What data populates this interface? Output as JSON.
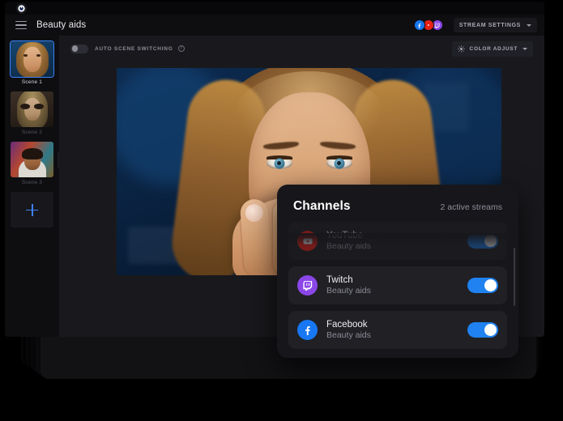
{
  "app": {
    "logo_icon": "power-logo-icon",
    "title": "Beauty aids",
    "menu_icon": "hamburger-menu-icon"
  },
  "titlebar": {
    "socials": [
      {
        "name": "facebook",
        "glyph": "f",
        "color": "#1877f2"
      },
      {
        "name": "youtube",
        "glyph": "▶",
        "color": "#e62117"
      },
      {
        "name": "twitch",
        "glyph": "▣",
        "color": "#8b46e8"
      }
    ],
    "stream_settings_label": "STREAM SETTINGS",
    "stream_settings_icon": "chevron-down-icon"
  },
  "sidebar": {
    "scenes": [
      {
        "label": "Scene 1",
        "active": true
      },
      {
        "label": "Scene 2",
        "active": false
      },
      {
        "label": "Scene 3",
        "active": false
      }
    ],
    "add_scene_icon": "plus-icon",
    "collapse_icon": "chevron-right-icon"
  },
  "stage": {
    "auto_scene_switching_label": "AUTO SCENE SWITCHING",
    "auto_scene_switching_on": false,
    "info_icon": "info-icon",
    "info_glyph": "?",
    "color_adjust_label": "COLOR ADJUST",
    "color_adjust_icon": "brightness-icon",
    "color_adjust_chevron": "chevron-down-icon",
    "bottom_icons": [
      {
        "name": "audio-mixer-icon"
      },
      {
        "name": "camera-snapshot-icon"
      }
    ]
  },
  "channels": {
    "title": "Channels",
    "active_streams": "2 active streams",
    "rows": [
      {
        "name": "YouTube",
        "subtitle": "Beauty aids",
        "icon": "youtube-icon",
        "enabled": true,
        "faded": true
      },
      {
        "name": "Twitch",
        "subtitle": "Beauty aids",
        "icon": "twitch-icon",
        "enabled": true,
        "faded": false
      },
      {
        "name": "Facebook",
        "subtitle": "Beauty aids",
        "icon": "facebook-icon",
        "enabled": true,
        "faded": false
      }
    ]
  },
  "colors": {
    "accent_blue": "#1f82f0",
    "youtube_red": "#e62117",
    "twitch_purple": "#8b46e8",
    "facebook_blue": "#1877f2",
    "window_bg": "#0b0b0d",
    "panel_bg": "#17171b"
  }
}
